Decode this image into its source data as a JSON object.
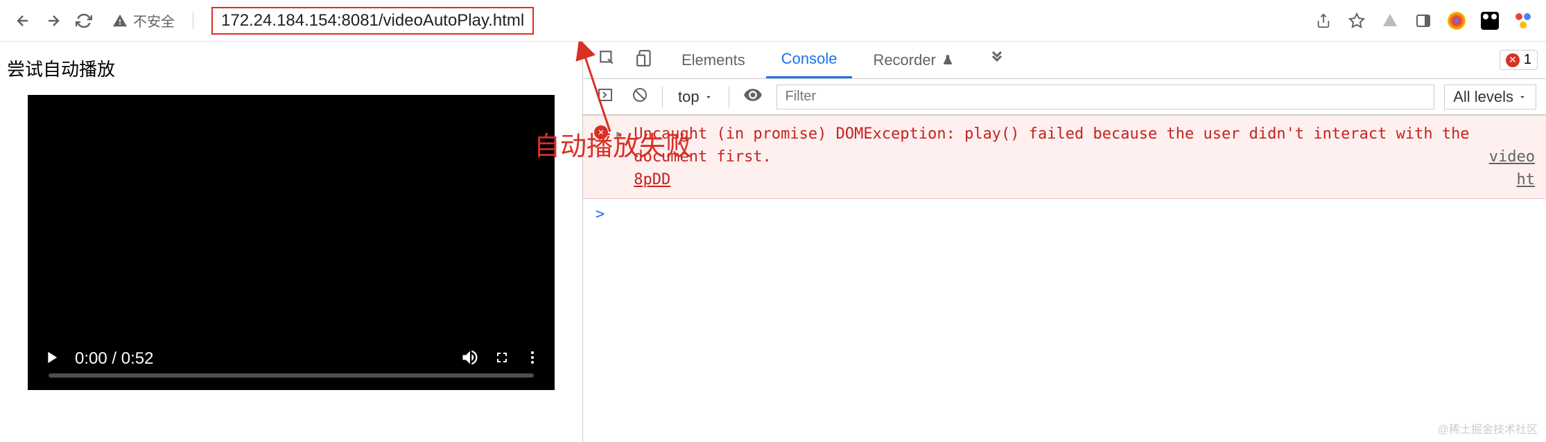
{
  "toolbar": {
    "security_label": "不安全",
    "url": "172.24.184.154:8081/videoAutoPlay.html"
  },
  "page": {
    "title": "尝试自动播放",
    "video": {
      "current_time": "0:00",
      "duration": "0:52",
      "time_display": "0:00 / 0:52"
    }
  },
  "annotation": {
    "text": "自动播放失败"
  },
  "devtools": {
    "tabs": {
      "elements": "Elements",
      "console": "Console",
      "recorder": "Recorder"
    },
    "error_count": "1",
    "filterbar": {
      "context": "top",
      "filter_placeholder": "Filter",
      "levels": "All levels"
    },
    "error": {
      "message": "Uncaught (in promise) DOMException: play() failed because the user didn't interact with the document first.",
      "source_link": "video",
      "help_link_prefix": "ht",
      "code": "8pDD"
    },
    "prompt": ">"
  },
  "watermark": "@稀土掘金技术社区"
}
